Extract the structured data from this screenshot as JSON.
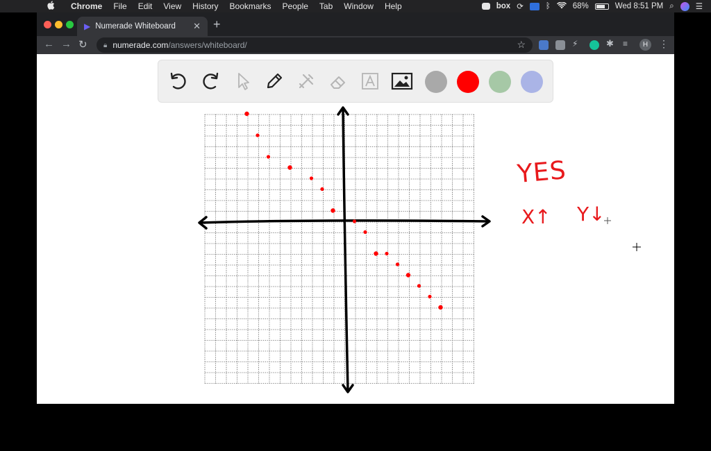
{
  "menubar": {
    "apple": "",
    "items": [
      "Chrome",
      "File",
      "Edit",
      "View",
      "History",
      "Bookmarks",
      "People",
      "Tab",
      "Window",
      "Help"
    ],
    "battery": "68%",
    "clock": "Wed 8:51 PM",
    "box_label": "box"
  },
  "browser": {
    "tab_title": "Numerade Whiteboard",
    "url_host": "numerade.com",
    "url_path": "/answers/whiteboard/",
    "avatar_letter": "H"
  },
  "whiteboard": {
    "tools": [
      "undo-icon",
      "redo-icon",
      "pointer-icon",
      "pen-icon",
      "tools-icon",
      "eraser-icon",
      "text-icon",
      "image-icon"
    ],
    "colors": [
      "#a9a9a9",
      "#ff0000",
      "#a6c8a6",
      "#aab4e6"
    ],
    "selected_color": "#ff0000",
    "handwriting": {
      "yes": "YES",
      "x_note": "X↑",
      "y_note": "Y↓"
    },
    "scatter_points": [
      [
        -9,
        10
      ],
      [
        -8,
        8
      ],
      [
        -7,
        6
      ],
      [
        -5,
        5
      ],
      [
        -3,
        4
      ],
      [
        -2,
        3
      ],
      [
        -1,
        1
      ],
      [
        1,
        0
      ],
      [
        2,
        -1
      ],
      [
        3,
        -3
      ],
      [
        4,
        -3
      ],
      [
        5,
        -4
      ],
      [
        6,
        -5
      ],
      [
        7,
        -6
      ],
      [
        8,
        -7
      ],
      [
        9,
        -8
      ]
    ]
  }
}
